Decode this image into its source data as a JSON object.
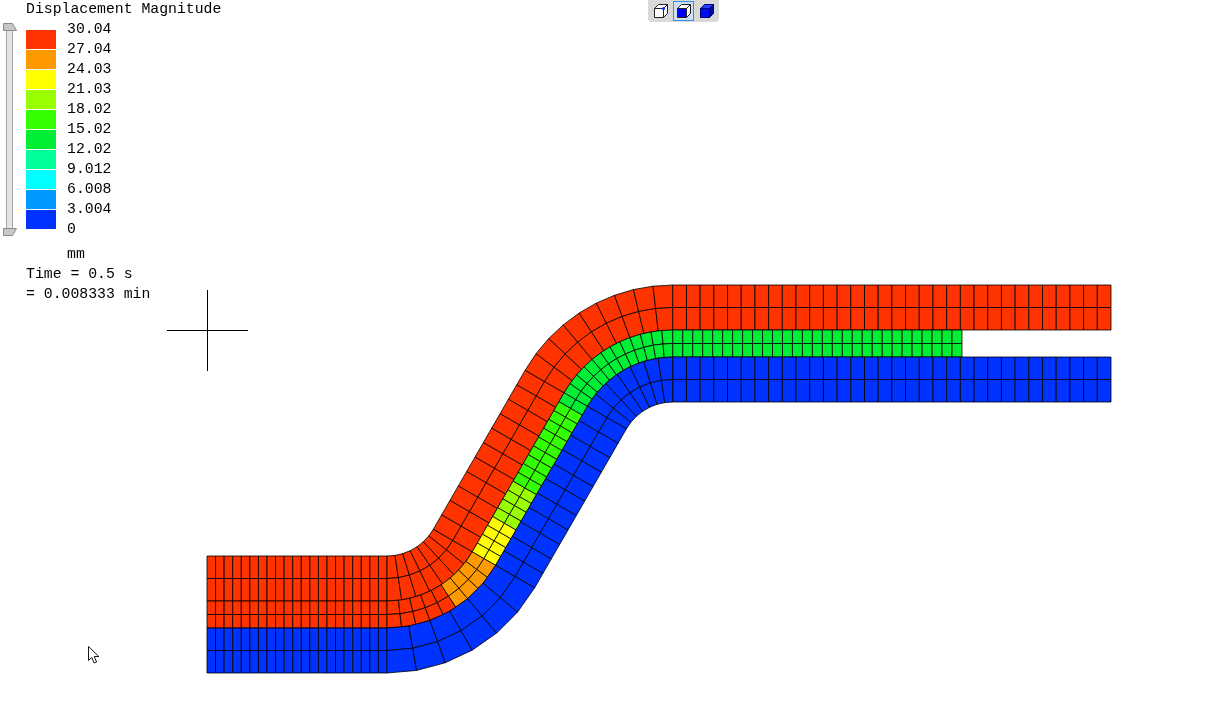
{
  "legend": {
    "title": "Displacement Magnitude",
    "bands": [
      {
        "color": "#ff3300"
      },
      {
        "color": "#ff9900"
      },
      {
        "color": "#ffff00"
      },
      {
        "color": "#99ff00"
      },
      {
        "color": "#33ff00"
      },
      {
        "color": "#00ee33"
      },
      {
        "color": "#00ff99"
      },
      {
        "color": "#00ffff"
      },
      {
        "color": "#0099ff"
      },
      {
        "color": "#0033ff"
      }
    ],
    "levels": [
      "30.04",
      "27.04",
      "24.03",
      "21.03",
      "18.02",
      "15.02",
      "12.02",
      "9.012",
      "6.008",
      "3.004",
      "0"
    ],
    "unit": "mm"
  },
  "time_lines": [
    "Time = 0.5 s",
    "= 0.008333 min"
  ],
  "view_toolbar": {
    "buttons": [
      {
        "kind": "wireframe",
        "selected": false
      },
      {
        "kind": "shaded-edges",
        "selected": true
      },
      {
        "kind": "shaded",
        "selected": false
      }
    ]
  },
  "model": {
    "layers": [
      {
        "kind": "upper"
      },
      {
        "kind": "middle"
      },
      {
        "kind": "lower"
      }
    ]
  }
}
